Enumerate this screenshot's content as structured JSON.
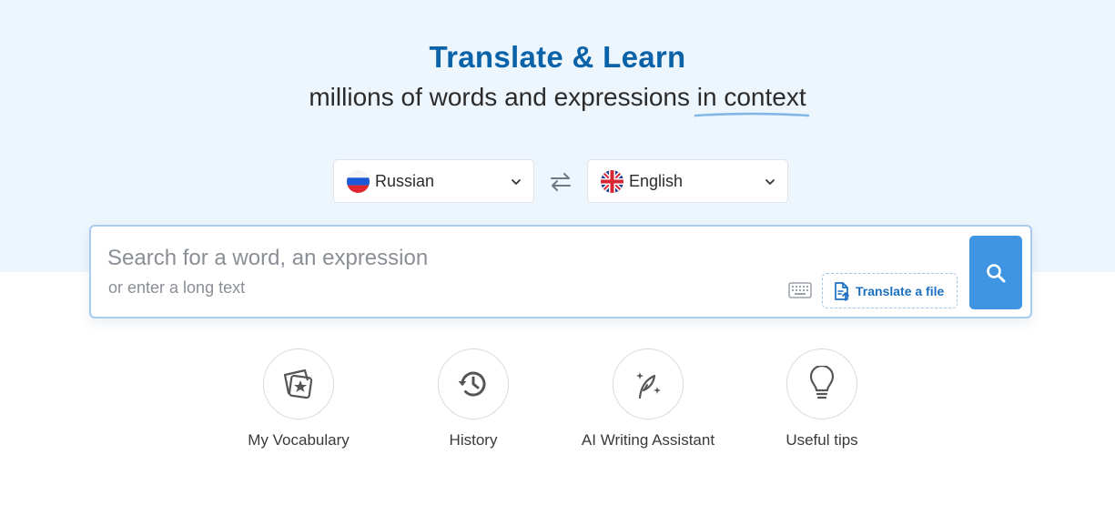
{
  "hero": {
    "title": "Translate & Learn",
    "subtitle_main": "millions of words and expressions",
    "subtitle_highlight": "in context"
  },
  "languages": {
    "source": {
      "name": "Russian",
      "flag": "russia-flag-icon"
    },
    "target": {
      "name": "English",
      "flag": "uk-flag-icon"
    },
    "swap_icon": "swap-arrows-icon"
  },
  "search": {
    "placeholder": "Search for a word, an expression",
    "hint": "or enter a long text",
    "keyboard_icon": "keyboard-icon",
    "translate_file_label": "Translate a file",
    "search_icon": "search-icon"
  },
  "features": [
    {
      "label": "My Vocabulary",
      "icon": "vocabulary-cards-icon"
    },
    {
      "label": "History",
      "icon": "history-clock-icon"
    },
    {
      "label": "AI Writing Assistant",
      "icon": "quill-sparkle-icon"
    },
    {
      "label": "Useful tips",
      "icon": "lightbulb-icon"
    }
  ],
  "colors": {
    "brand_blue": "#0a62a8",
    "accent_blue": "#3f95e2",
    "hero_background": "#eef6fd",
    "highlight_underline": "#7fb6e6"
  }
}
